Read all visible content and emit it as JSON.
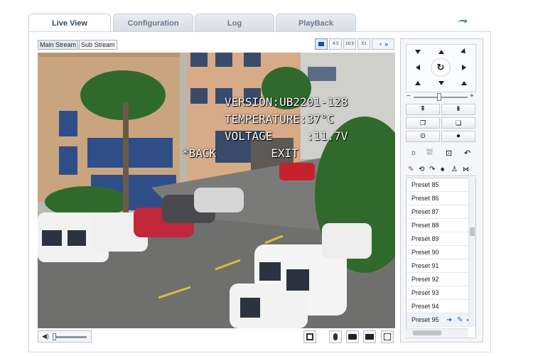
{
  "tabs": [
    {
      "label": "Live View",
      "active": true
    },
    {
      "label": "Configuration",
      "active": false
    },
    {
      "label": "Log",
      "active": false
    },
    {
      "label": "PlayBack",
      "active": false
    }
  ],
  "stream": {
    "main_label": "Main Stream",
    "sub_label": "Sub Stream",
    "selected": "Main Stream"
  },
  "aspect_buttons": [
    {
      "label": "",
      "icon": "original-ratio-icon",
      "active": true
    },
    {
      "label": "4:3"
    },
    {
      "label": "16:9"
    },
    {
      "label": "X1"
    }
  ],
  "osd": {
    "line1": "VERSION:UB2201-128",
    "line2": "TEMPERATURE:37°C",
    "line3": "VOLTAGE     :11.7V",
    "line4": "*BACK        EXIT"
  },
  "ptz": {
    "presets": [
      "Preset 85",
      "Preset 86",
      "Preset 87",
      "Preset 88",
      "Preset 89",
      "Preset 90",
      "Preset 91",
      "Preset 92",
      "Preset 93",
      "Preset 94",
      "Preset 95"
    ],
    "selected_preset": "Preset 95",
    "speed_level": 0.45
  },
  "colors": {
    "accent": "#3a72c9",
    "tab_text": "#6b7a8a"
  }
}
